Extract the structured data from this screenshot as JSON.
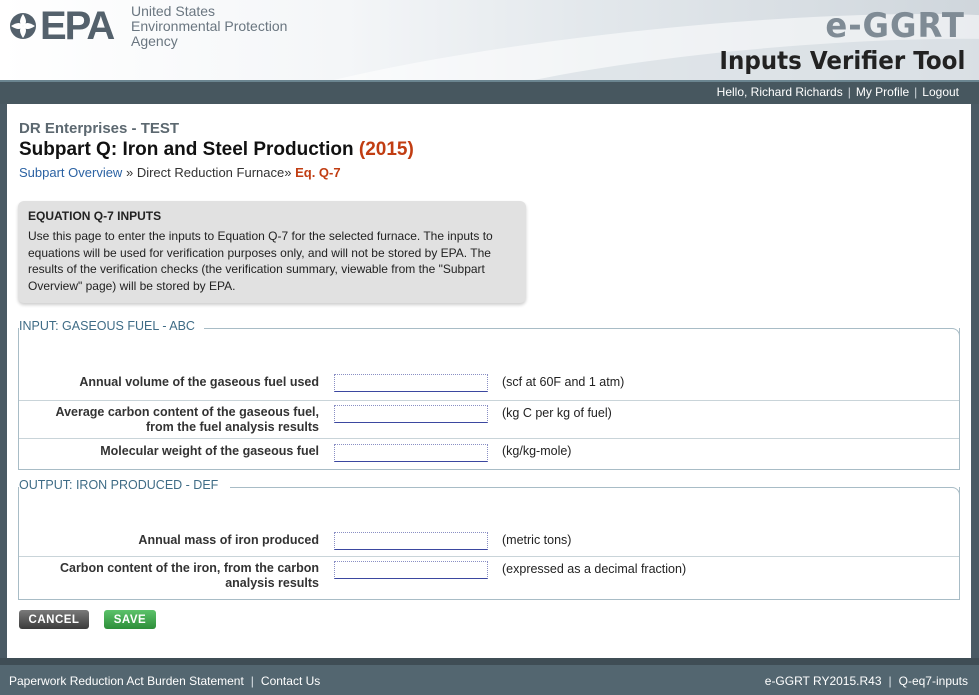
{
  "header": {
    "logo_text": "EPA",
    "agency_line1": "United States",
    "agency_line2": "Environmental Protection",
    "agency_line3": "Agency",
    "app_name": "e-GGRT",
    "tool_name": "Inputs Verifier Tool"
  },
  "nav": {
    "greeting": "Hello, Richard Richards",
    "my_profile": "My Profile",
    "logout": "Logout",
    "sep": "|"
  },
  "page": {
    "company": "DR Enterprises - TEST",
    "title": "Subpart Q: Iron and Steel Production",
    "year": "(2015)",
    "breadcrumb": {
      "overview": "Subpart Overview",
      "sep": "»",
      "furnace": "Direct Reduction Furnace",
      "current": "Eq. Q-7"
    }
  },
  "info": {
    "heading": "EQUATION Q-7 INPUTS",
    "body": "Use this page to enter the inputs to Equation Q-7 for the selected furnace. The inputs to equations will be used for verification purposes only, and will not be stored by EPA. The results of the verification checks (the verification summary, viewable from the \"Subpart Overview\" page) will be stored by EPA."
  },
  "sections": {
    "input": {
      "legend": "INPUT: GASEOUS FUEL - ABC",
      "rows": [
        {
          "label": "Annual volume of the gaseous fuel used",
          "value": "",
          "unit": "(scf at 60F and 1 atm)"
        },
        {
          "label_line1": "Average carbon content of the gaseous fuel,",
          "label_line2": "from the fuel analysis results",
          "value": "",
          "unit": "(kg C per kg of fuel)"
        },
        {
          "label": "Molecular weight of the gaseous fuel",
          "value": "",
          "unit": "(kg/kg-mole)"
        }
      ]
    },
    "output": {
      "legend": "OUTPUT: IRON PRODUCED - DEF",
      "rows": [
        {
          "label": "Annual mass of iron produced",
          "value": "",
          "unit": "(metric tons)"
        },
        {
          "label_line1": "Carbon content of the iron, from the carbon",
          "label_line2": "analysis results",
          "value": "",
          "unit": "(expressed as a decimal fraction)"
        }
      ]
    }
  },
  "buttons": {
    "cancel": "CANCEL",
    "save": "SAVE"
  },
  "footer": {
    "paperwork": "Paperwork Reduction Act Burden Statement",
    "contact": "Contact Us",
    "version": "e-GGRT RY2015.R43",
    "page_id": "Q-eq7-inputs",
    "sep": "|"
  },
  "colors": {
    "accent_red": "#c13d12",
    "link_blue": "#2b62a3",
    "nav_bg": "#47575f",
    "save_green": "#2d8e39"
  }
}
